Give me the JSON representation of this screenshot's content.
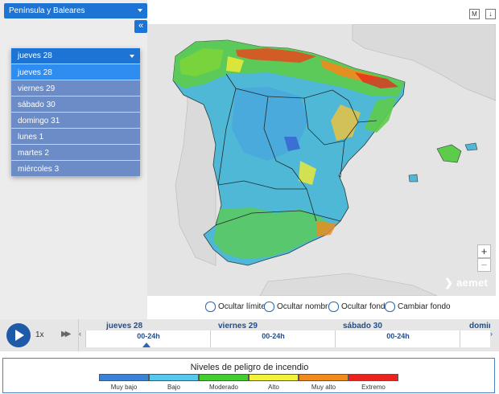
{
  "region_select": {
    "value": "Península y Baleares"
  },
  "collapse_button": "«",
  "day_dropdown": {
    "selected": "jueves 28",
    "options": [
      "jueves 28",
      "viernes 29",
      "sábado 30",
      "domingo 31",
      "lunes 1",
      "martes 2",
      "miércoles 3"
    ],
    "active_index": 0
  },
  "map": {
    "toolbar_m": "M",
    "toolbar_download": "↓",
    "zoom_in": "+",
    "zoom_out": "−",
    "logo": "aemet"
  },
  "toggles": [
    "Ocultar límites",
    "Ocultar nombres",
    "Ocultar fondo",
    "Cambiar fondo"
  ],
  "timeline": {
    "speed": "1x",
    "days": [
      {
        "name": "jueves 28",
        "slot": "00-24h"
      },
      {
        "name": "viernes 29",
        "slot": "00-24h"
      },
      {
        "name": "sábado 30",
        "slot": "00-24h"
      },
      {
        "name": "domin",
        "slot": ""
      }
    ]
  },
  "legend": {
    "title": "Niveles de peligro de incendio",
    "levels": [
      {
        "label": "Muy bajo",
        "color": "#3a82d4"
      },
      {
        "label": "Bajo",
        "color": "#55c8ee"
      },
      {
        "label": "Moderado",
        "color": "#44cc33"
      },
      {
        "label": "Alto",
        "color": "#f2f23a"
      },
      {
        "label": "Muy alto",
        "color": "#f08a1c"
      },
      {
        "label": "Extremo",
        "color": "#e8241c"
      }
    ]
  }
}
